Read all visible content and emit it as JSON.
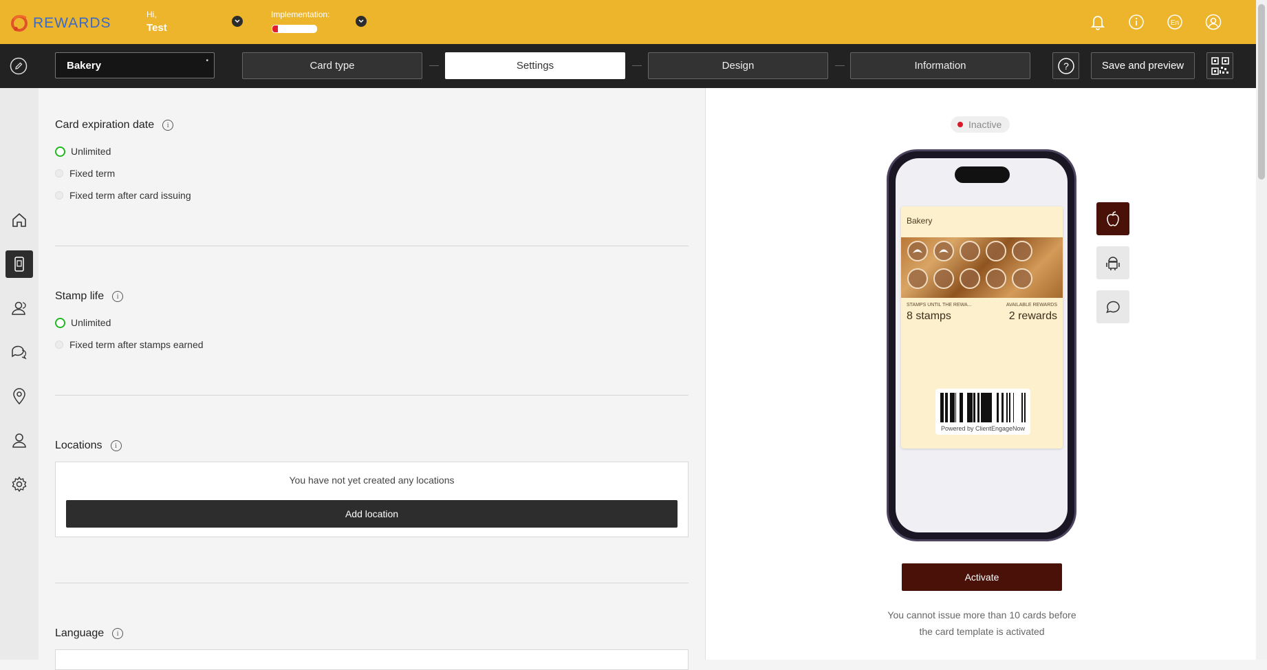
{
  "header": {
    "logo_text": "REWARDS",
    "greeting": "Hi,",
    "user_name": "Test",
    "implementation_label": "Implementation:",
    "implementation_progress": 0.12,
    "colors": {
      "bar": "#ecb52b",
      "progress": "#e31d2b"
    }
  },
  "steps": {
    "card_name": "Bakery",
    "items": [
      {
        "label": "Card type"
      },
      {
        "label": "Settings"
      },
      {
        "label": "Design"
      },
      {
        "label": "Information"
      }
    ],
    "active": "Settings",
    "save_label": "Save and preview"
  },
  "sidebar": {
    "icons": [
      "home-icon",
      "card-icon",
      "users-icon",
      "chat-icon",
      "location-icon",
      "profile-icon",
      "gear-icon"
    ],
    "active": "card-icon"
  },
  "settings": {
    "expiration": {
      "title": "Card expiration date",
      "options": [
        "Unlimited",
        "Fixed term",
        "Fixed term after card issuing"
      ],
      "selected": "Unlimited"
    },
    "stamp_life": {
      "title": "Stamp life",
      "options": [
        "Unlimited",
        "Fixed term after stamps earned"
      ],
      "selected": "Unlimited"
    },
    "locations": {
      "title": "Locations",
      "empty_text": "You have not yet created any locations",
      "add_label": "Add location"
    },
    "language": {
      "title": "Language"
    }
  },
  "preview": {
    "status": "Inactive",
    "card": {
      "title": "Bakery",
      "stamps_label": "STAMPS UNTIL THE REWA...",
      "stamps_value": "8 stamps",
      "rewards_label": "AVAILABLE REWARDS",
      "rewards_value": "2 rewards",
      "stamps_earned": 2,
      "stamps_total": 10,
      "powered_by": "Powered by ClientEngageNow"
    },
    "platforms": [
      "apple-icon",
      "android-icon",
      "message-icon"
    ],
    "active_platform": "apple-icon",
    "activate_label": "Activate",
    "note_line1": "You cannot issue more than 10 cards before",
    "note_line2": "the card template is activated",
    "colors": {
      "accent": "#4a1108",
      "card_bg": "#fdf0cc",
      "inactive_dot": "#d81b2a"
    }
  }
}
